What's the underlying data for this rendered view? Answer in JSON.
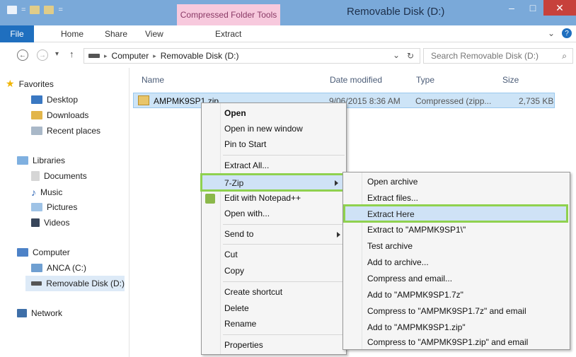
{
  "window": {
    "title": "Removable Disk (D:)",
    "tools_tab": "Compressed Folder Tools",
    "minimize": "–",
    "maximize": "□",
    "close": "✕",
    "qat_sep": "="
  },
  "ribbon": {
    "tabs": [
      "File",
      "Home",
      "Share",
      "View",
      "Extract"
    ],
    "expand": "⌄",
    "help": "?"
  },
  "addressbar": {
    "back": "←",
    "forward": "→",
    "dropdown": "▾",
    "up": "↑",
    "crumbs": [
      "Computer",
      "Removable Disk (D:)"
    ],
    "crumb_sep": "▸",
    "history": "⌄",
    "refresh": "↻",
    "search_placeholder": "Search Removable Disk (D:)",
    "search_icon": "⌕"
  },
  "navpane": {
    "favorites": "Favorites",
    "desktop": "Desktop",
    "downloads": "Downloads",
    "recent": "Recent places",
    "libraries": "Libraries",
    "documents": "Documents",
    "music": "Music",
    "pictures": "Pictures",
    "videos": "Videos",
    "computer": "Computer",
    "anca": "ANCA (C:)",
    "removable": "Removable Disk (D:)",
    "network": "Network"
  },
  "columns": {
    "name": "Name",
    "date": "Date modified",
    "type": "Type",
    "size": "Size"
  },
  "file": {
    "name": "AMPMK9SP1.zip",
    "date": "9/06/2015 8:36 AM",
    "type": "Compressed (zipp...",
    "size": "2,735 KB"
  },
  "context_menu": {
    "open": "Open",
    "open_new_window": "Open in new window",
    "pin_to_start": "Pin to Start",
    "extract_all": "Extract All...",
    "seven_zip": "7-Zip",
    "edit_notepad": "Edit with Notepad++",
    "open_with": "Open with...",
    "send_to": "Send to",
    "cut": "Cut",
    "copy": "Copy",
    "create_shortcut": "Create shortcut",
    "delete": "Delete",
    "rename": "Rename",
    "properties": "Properties"
  },
  "submenu": {
    "open_archive": "Open archive",
    "extract_files": "Extract files...",
    "extract_here": "Extract Here",
    "extract_to": "Extract to \"AMPMK9SP1\\\"",
    "test_archive": "Test archive",
    "add_to_archive": "Add to archive...",
    "compress_email": "Compress and email...",
    "add_7z": "Add to \"AMPMK9SP1.7z\"",
    "compress_7z_email": "Compress to \"AMPMK9SP1.7z\" and email",
    "add_zip": "Add to \"AMPMK9SP1.zip\"",
    "compress_zip_email": "Compress to \"AMPMK9SP1.zip\" and email"
  },
  "colors": {
    "titlebar": "#7aa9d9",
    "file_tab": "#1f6fbf",
    "tools_tab": "#f7c9dd",
    "selection": "#cde4f7",
    "highlight_border": "#8fd14f",
    "close_button": "#c7413b"
  }
}
